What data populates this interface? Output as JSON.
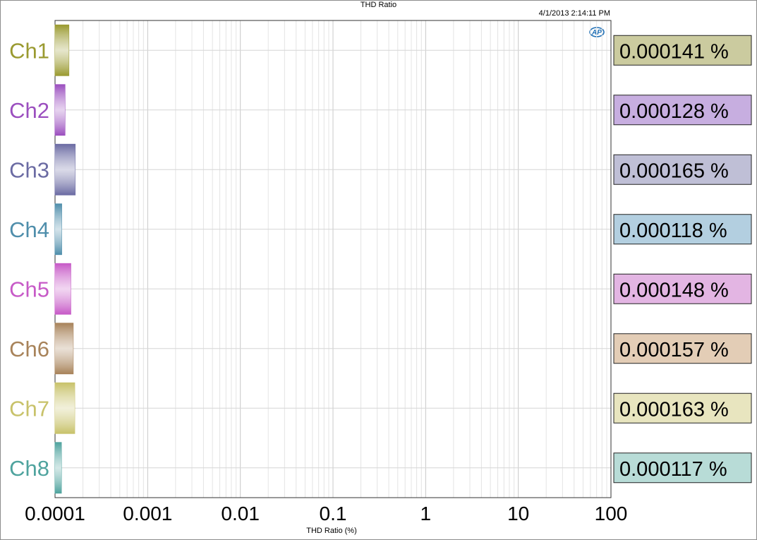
{
  "title": "THD Ratio",
  "timestamp": "4/1/2013 2:14:11 PM",
  "logo": {
    "icon": "ap-logo-icon",
    "color": "#1f6fb5"
  },
  "chart_data": {
    "type": "bar",
    "orientation": "horizontal",
    "title": "THD Ratio",
    "xlabel": "THD Ratio (%)",
    "ylabel": "",
    "xscale": "log",
    "xlim": [
      0.0001,
      100
    ],
    "xticks": [
      "0.0001",
      "0.001",
      "0.01",
      "0.1",
      "1",
      "10",
      "100"
    ],
    "grid": true,
    "categories": [
      "Ch1",
      "Ch2",
      "Ch3",
      "Ch4",
      "Ch5",
      "Ch6",
      "Ch7",
      "Ch8"
    ],
    "values": [
      0.000141,
      0.000128,
      0.000165,
      0.000118,
      0.000148,
      0.000157,
      0.000163,
      0.000117
    ],
    "readouts": [
      "0.000141 %",
      "0.000128 %",
      "0.000165 %",
      "0.000118 %",
      "0.000148 %",
      "0.000157 %",
      "0.000163 %",
      "0.000117 %"
    ],
    "colors": [
      "#9a9a30",
      "#9b4fbf",
      "#6b6ba3",
      "#4f8eab",
      "#c75ac7",
      "#a8835a",
      "#c8c26a",
      "#4fa39e"
    ],
    "readout_bg": [
      "#cbcb9f",
      "#c7aee0",
      "#bfbfd6",
      "#b3cfe0",
      "#e3b5e3",
      "#e3cdb6",
      "#e8e5bf",
      "#b8dcd7"
    ]
  }
}
